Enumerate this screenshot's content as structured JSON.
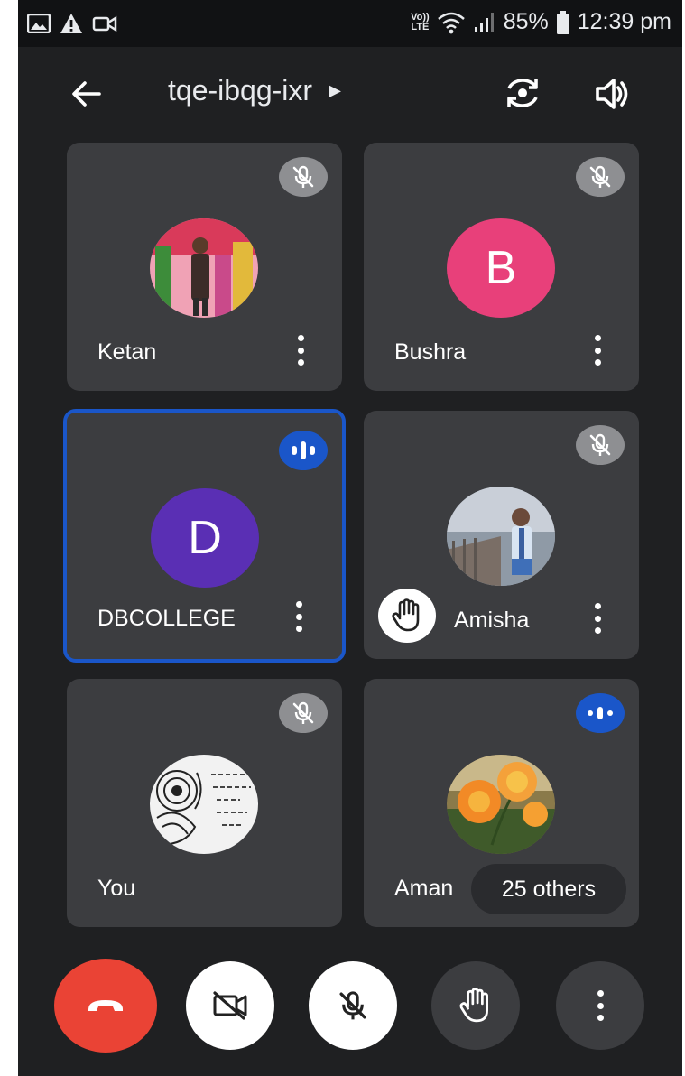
{
  "status_bar": {
    "network_label_top": "Vo))",
    "network_label_bottom": "LTE",
    "battery": "85%",
    "time": "12:39 pm"
  },
  "header": {
    "meeting_code": "tqe-ibqg-ixr"
  },
  "participants": [
    {
      "name": "Ketan",
      "avatar": "photo",
      "mic": "muted"
    },
    {
      "name": "Bushra",
      "avatar_letter": "B",
      "avatar_color": "#e8407a",
      "mic": "muted"
    },
    {
      "name": "DBCOLLEGE",
      "avatar_letter": "D",
      "avatar_color": "#5a2fb4",
      "mic": "speaking",
      "active": true
    },
    {
      "name": "Amisha",
      "avatar": "photo",
      "mic": "muted",
      "hand_raised": true
    },
    {
      "name": "You",
      "avatar": "photo",
      "mic": "muted"
    },
    {
      "name": "Aman",
      "avatar": "photo",
      "mic": "speaking"
    }
  ],
  "others_pill": "25 others",
  "colors": {
    "background": "#1f2022",
    "tile": "#3c3d40",
    "active_border": "#1a56c9",
    "end_call": "#ea4335"
  },
  "controls": [
    "end-call-icon",
    "camera-off-icon",
    "mic-off-icon",
    "raise-hand-icon",
    "more-icon"
  ]
}
